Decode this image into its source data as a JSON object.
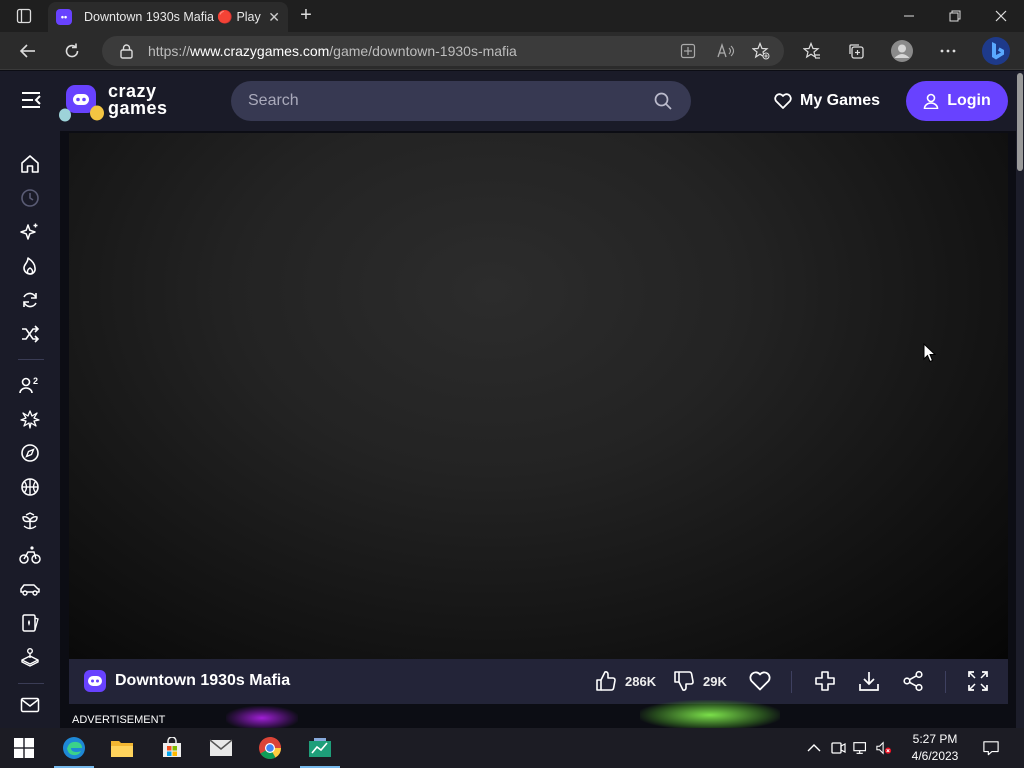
{
  "browser": {
    "tab_title": "Downtown 1930s Mafia 🔴 Play",
    "tab_close": "✕",
    "new_tab": "+",
    "url_prefix": "https://",
    "url_domain": "www.crazygames.com",
    "url_path": "/game/downtown-1930s-mafia"
  },
  "site": {
    "logo_line1": "crazy",
    "logo_line2": "games",
    "search_placeholder": "Search",
    "my_games_label": "My Games",
    "login_label": "Login",
    "brand_color": "#6842ff"
  },
  "rail": {
    "items": [
      "home-icon",
      "recent-icon",
      "new-icon",
      "trending-icon",
      "updated-icon",
      "random-icon",
      "multiplayer-icon",
      "action-icon",
      "adventure-icon",
      "basketball-icon",
      "casual-icon",
      "bike-icon",
      "car-icon",
      "cards-icon",
      "controller-icon",
      "mail-icon"
    ]
  },
  "game": {
    "title": "Downtown 1930s Mafia",
    "likes": "286K",
    "dislikes": "29K"
  },
  "ad": {
    "label": "ADVERTISEMENT"
  },
  "taskbar": {
    "time": "5:27 PM",
    "date": "4/6/2023"
  }
}
